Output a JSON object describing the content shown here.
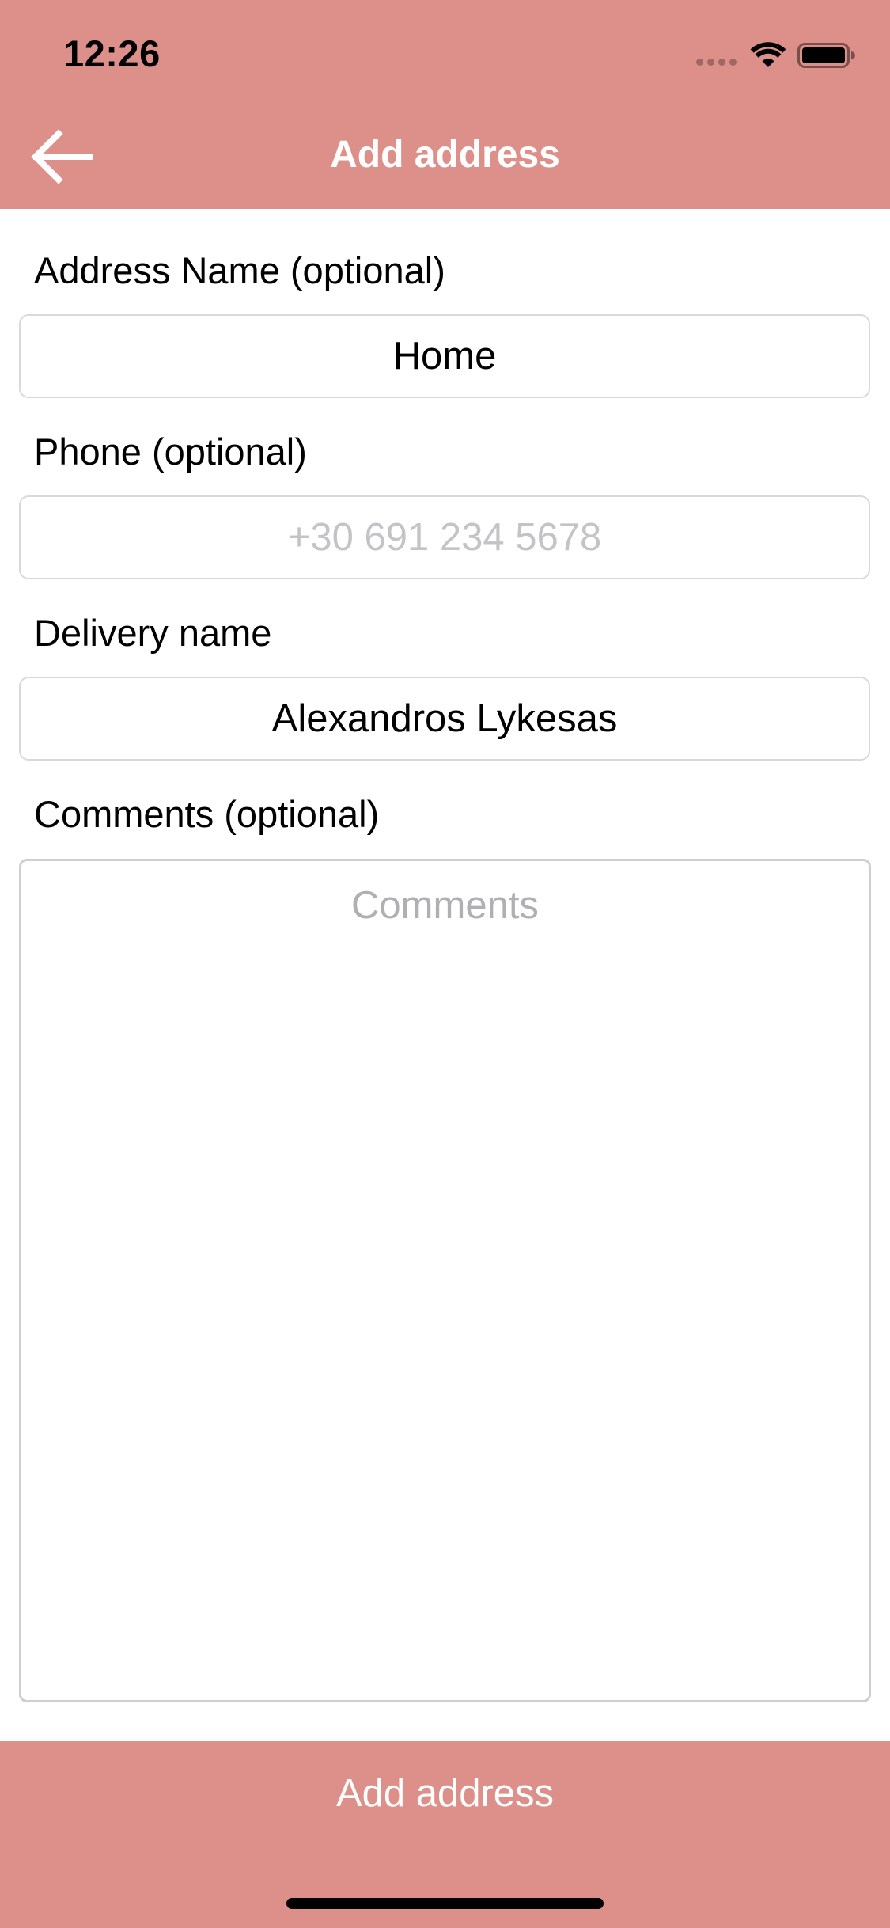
{
  "status_bar": {
    "time": "12:26"
  },
  "header": {
    "title": "Add address",
    "back_icon": "arrow-left-icon",
    "background_color": "#dd908a"
  },
  "form": {
    "address_name": {
      "label": "Address Name (optional)",
      "value": "Home",
      "placeholder": ""
    },
    "phone": {
      "label": "Phone (optional)",
      "value": "",
      "placeholder": "+30 691 234 5678"
    },
    "delivery_name": {
      "label": "Delivery name",
      "value": "Alexandros Lykesas",
      "placeholder": ""
    },
    "comments": {
      "label": "Comments (optional)",
      "value": "",
      "placeholder": "Comments"
    }
  },
  "footer": {
    "button_label": "Add address",
    "background_color": "#dd908a"
  }
}
